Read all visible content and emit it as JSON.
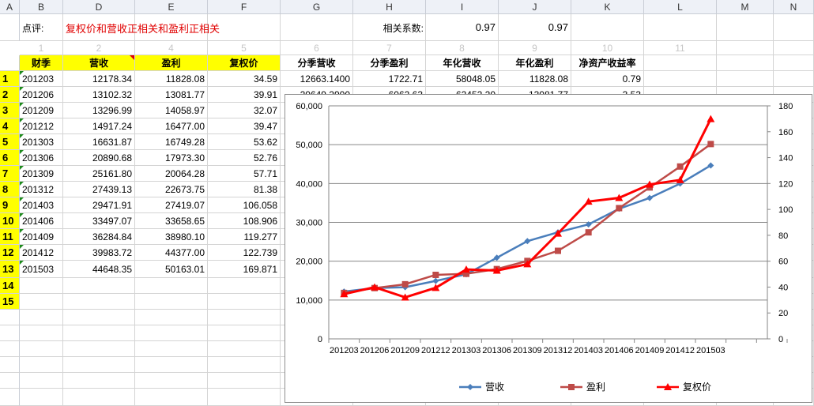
{
  "col_headers": [
    "A",
    "B",
    "D",
    "E",
    "F",
    "G",
    "H",
    "I",
    "J",
    "K",
    "L",
    "M",
    "N"
  ],
  "comment": {
    "label": "点评:",
    "text": "复权价和营收正相关和盈利正相关"
  },
  "correlation": {
    "label": "相关系数:",
    "value1": "0.97",
    "value2": "0.97"
  },
  "index_row": [
    "1",
    "2",
    "4",
    "5",
    "6",
    "7",
    "8",
    "9",
    "10",
    "11"
  ],
  "table": {
    "headers": [
      "财季",
      "营收",
      "盈利",
      "复权价",
      "分季营收",
      "分季盈利",
      "年化营收",
      "年化盈利",
      "净资产收益率"
    ],
    "row_numbers": [
      "1",
      "2",
      "3",
      "4",
      "5",
      "6",
      "7",
      "8",
      "9",
      "10",
      "11",
      "12",
      "13",
      "14",
      "15"
    ],
    "rows": [
      [
        "201203",
        "12178.34",
        "11828.08",
        "34.59",
        "12663.1400",
        "1722.71",
        "58048.05",
        "11828.08",
        "0.79"
      ],
      [
        "201206",
        "13102.32",
        "13081.77",
        "39.91",
        "20649.2900",
        "6062.63",
        "62452.20",
        "13081.77",
        "3.53"
      ],
      [
        "201209",
        "13296.99",
        "14058.97",
        "32.07",
        "",
        "",
        "",
        "",
        ""
      ],
      [
        "201212",
        "14917.24",
        "16477.00",
        "39.47",
        "",
        "",
        "",
        "",
        ""
      ],
      [
        "201303",
        "16631.87",
        "16749.28",
        "53.62",
        "",
        "",
        "",
        "",
        ""
      ],
      [
        "201306",
        "20890.68",
        "17973.30",
        "52.76",
        "",
        "",
        "",
        "",
        ""
      ],
      [
        "201309",
        "25161.80",
        "20064.28",
        "57.71",
        "",
        "",
        "",
        "",
        ""
      ],
      [
        "201312",
        "27439.13",
        "22673.75",
        "81.38",
        "",
        "",
        "",
        "",
        ""
      ],
      [
        "201403",
        "29471.91",
        "27419.07",
        "106.058",
        "",
        "",
        "",
        "",
        ""
      ],
      [
        "201406",
        "33497.07",
        "33658.65",
        "108.906",
        "",
        "",
        "",
        "",
        ""
      ],
      [
        "201409",
        "36284.84",
        "38980.10",
        "119.277",
        "",
        "",
        "",
        "",
        ""
      ],
      [
        "201412",
        "39983.72",
        "44377.00",
        "122.739",
        "",
        "",
        "",
        "",
        ""
      ],
      [
        "201503",
        "44648.35",
        "50163.01",
        "169.871",
        "",
        "",
        "",
        "",
        ""
      ]
    ]
  },
  "chart_data": {
    "type": "line",
    "categories": [
      "201203",
      "201206",
      "201209",
      "201212",
      "201303",
      "201306",
      "201309",
      "201312",
      "201403",
      "201406",
      "201409",
      "201412",
      "201503"
    ],
    "series": [
      {
        "name": "营收",
        "axis": "left",
        "color": "#4a7ebb",
        "marker": "diamond",
        "values": [
          12178.34,
          13102.32,
          13296.99,
          14917.24,
          16631.87,
          20890.68,
          25161.8,
          27439.13,
          29471.91,
          33497.07,
          36284.84,
          39983.72,
          44648.35
        ]
      },
      {
        "name": "盈利",
        "axis": "left",
        "color": "#be4b48",
        "marker": "square",
        "values": [
          11828.08,
          13081.77,
          14058.97,
          16477.0,
          16749.28,
          17973.3,
          20064.28,
          22673.75,
          27419.07,
          33658.65,
          38980.1,
          44377.0,
          50163.01
        ]
      },
      {
        "name": "复权价",
        "axis": "right",
        "color": "#ff0000",
        "marker": "triangle",
        "values": [
          34.59,
          39.91,
          32.07,
          39.47,
          53.62,
          52.76,
          57.71,
          81.38,
          106.058,
          108.906,
          119.277,
          122.739,
          169.871
        ]
      }
    ],
    "left_axis": {
      "min": 0,
      "max": 60000,
      "ticks": [
        "0",
        "10,000",
        "20,000",
        "30,000",
        "40,000",
        "50,000",
        "60,000"
      ]
    },
    "right_axis": {
      "min": 0,
      "max": 180,
      "ticks": [
        "0",
        "20",
        "40",
        "60",
        "80",
        "100",
        "120",
        "140",
        "160",
        "180"
      ]
    },
    "grid": true,
    "legend": "bottom"
  }
}
